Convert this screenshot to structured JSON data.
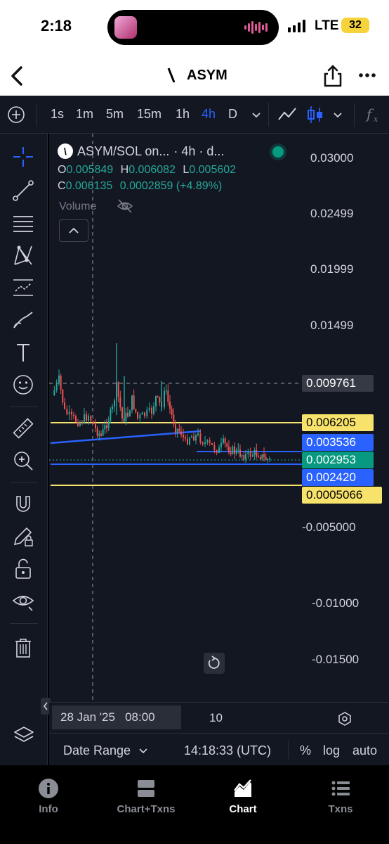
{
  "status": {
    "time": "2:18",
    "network": "LTE",
    "battery": "32"
  },
  "header": {
    "title": "ASYM",
    "logo_glyph": "\\"
  },
  "toolbar": {
    "timeframes": [
      "1s",
      "1m",
      "5m",
      "15m",
      "1h",
      "4h",
      "D"
    ],
    "active_timeframe": "4h"
  },
  "legend": {
    "pair": "ASYM/SOL on...",
    "interval": "· 4h · d...",
    "o_label": "O",
    "o_value": "0.005849",
    "h_label": "H",
    "h_value": "0.006082",
    "l_label": "L",
    "l_value": "0.005602",
    "c_label": "C",
    "c_value": "0.006135",
    "change": "0.0002859 (+4.89%)",
    "volume_label": "Volume"
  },
  "price_axis": [
    "0.03000",
    "0.02499",
    "0.01999",
    "0.01499",
    "-0.005000",
    "-0.01000",
    "-0.01500"
  ],
  "price_tags": {
    "crosshair": "0.009761",
    "yellow_top": "0.006205",
    "blue_top": "0.003536",
    "last": "0.002953",
    "blue_bottom": "0.002420",
    "yellow_bottom": "0.0005066"
  },
  "time_axis": {
    "crosshair_date": "28 Jan '25   08:00",
    "tick": "10"
  },
  "bottom_bar": {
    "date_range": "Date Range",
    "clock": "14:18:33 (UTC)",
    "percent": "%",
    "log": "log",
    "auto": "auto"
  },
  "tabs": [
    {
      "label": "Info",
      "icon": "info-icon"
    },
    {
      "label": "Chart+Txns",
      "icon": "split-view-icon"
    },
    {
      "label": "Chart",
      "icon": "chart-icon"
    },
    {
      "label": "Txns",
      "icon": "list-icon"
    }
  ],
  "active_tab": "Chart",
  "colors": {
    "up": "#26a69a",
    "down": "#ef5350",
    "blue_line": "#2962ff",
    "yellow_line": "#f7e26b",
    "background": "#131722"
  }
}
